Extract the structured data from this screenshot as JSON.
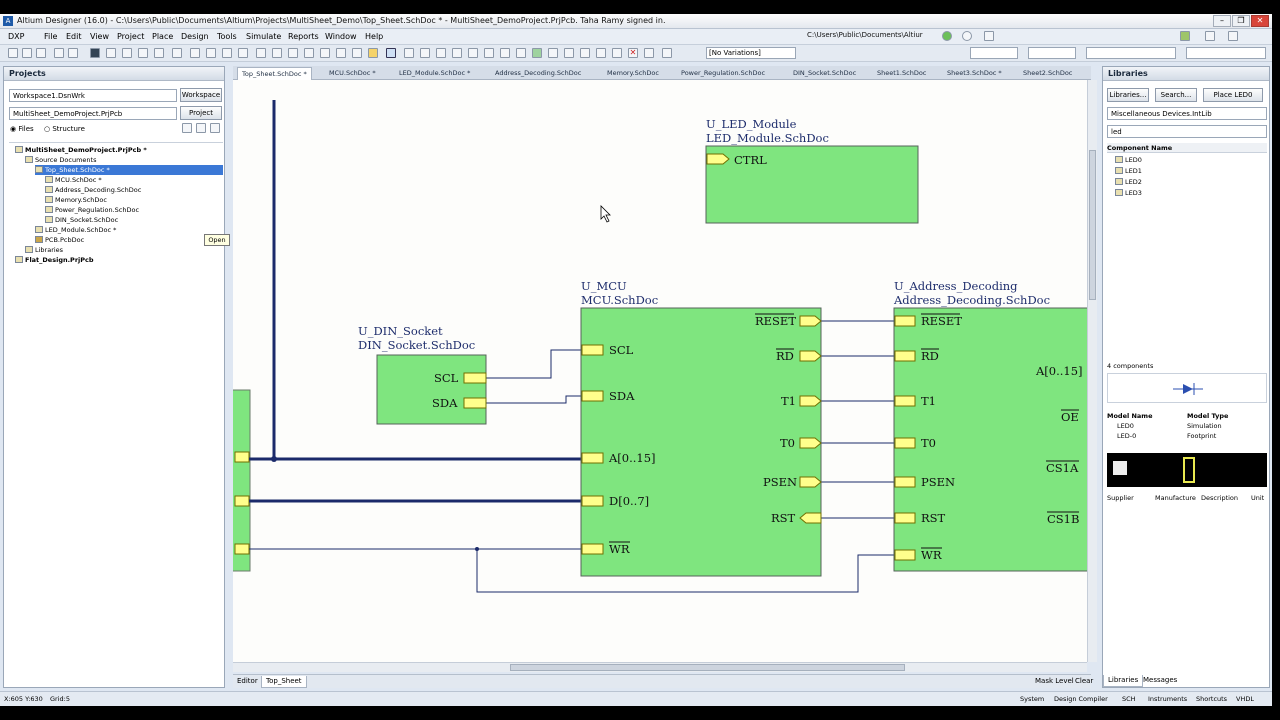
{
  "window": {
    "title": "Altium Designer (16.0) - C:\\Users\\Public\\Documents\\Altium\\Projects\\MultiSheet_Demo\\Top_Sheet.SchDoc * - MultiSheet_DemoProject.PrjPcb. Taha Ramy signed in.",
    "app_icon": "A"
  },
  "menu": {
    "items": [
      "DXP",
      "File",
      "Edit",
      "View",
      "Project",
      "Place",
      "Design",
      "Tools",
      "Simulate",
      "Reports",
      "Window",
      "Help"
    ],
    "path": "C:\\Users\\Public\\Documents\\Altiur"
  },
  "toolbar": {
    "variations": "[No Variations]"
  },
  "projects_panel": {
    "title": "Projects",
    "workspace_combo": "Workspace1.DsnWrk",
    "workspace_button": "Workspace",
    "project_combo": "MultiSheet_DemoProject.PrjPcb",
    "project_button": "Project",
    "files_label": "Files",
    "structure_label": "Structure",
    "tree": [
      {
        "label": "MultiSheet_DemoProject.PrjPcb *",
        "bold": true
      },
      {
        "label": "Source Documents"
      },
      {
        "label": "Top_Sheet.SchDoc *",
        "selected": true
      },
      {
        "label": "MCU.SchDoc *"
      },
      {
        "label": "Address_Decoding.SchDoc"
      },
      {
        "label": "Memory.SchDoc"
      },
      {
        "label": "Power_Regulation.SchDoc"
      },
      {
        "label": "DIN_Socket.SchDoc"
      },
      {
        "label": "LED_Module.SchDoc *"
      },
      {
        "label": "PCB.PcbDoc"
      },
      {
        "label": "Libraries"
      },
      {
        "label": "Flat_Design.PrjPcb",
        "bold": true
      }
    ],
    "tooltip": "Open"
  },
  "doc_tabs": [
    "Top_Sheet.SchDoc *",
    "MCU.SchDoc *",
    "LED_Module.SchDoc *",
    "Address_Decoding.SchDoc",
    "Memory.SchDoc",
    "Power_Regulation.SchDoc",
    "DIN_Socket.SchDoc",
    "Sheet1.SchDoc",
    "Sheet3.SchDoc *",
    "Sheet2.SchDoc"
  ],
  "schematic": {
    "led_module": {
      "designator": "U_LED_Module",
      "filename": "LED_Module.SchDoc",
      "ports": [
        "CTRL"
      ]
    },
    "din_socket": {
      "designator": "U_DIN_Socket",
      "filename": "DIN_Socket.SchDoc",
      "ports": [
        "SCL",
        "SDA"
      ]
    },
    "mcu": {
      "designator": "U_MCU",
      "filename": "MCU.SchDoc",
      "left_ports": [
        "SCL",
        "SDA",
        "A[0..15]",
        "D[0..7]",
        "WR"
      ],
      "right_ports": [
        "RESET",
        "RD",
        "T1",
        "T0",
        "PSEN",
        "RST"
      ]
    },
    "address_decoding": {
      "designator": "U_Address_Decoding",
      "filename": "Address_Decoding.SchDoc",
      "left_ports": [
        "RESET",
        "RD",
        "T1",
        "T0",
        "PSEN",
        "RST",
        "WR"
      ],
      "right_ports": [
        "A[0..15] [",
        "OE",
        "CS1A",
        "CS1B"
      ]
    }
  },
  "bottom_tabs": [
    "Editor",
    "Top_Sheet"
  ],
  "bottom_right": [
    "Mask Level",
    "Clear"
  ],
  "libraries_panel": {
    "title": "Libraries",
    "buttons": [
      "Libraries...",
      "Search...",
      "Place LED0"
    ],
    "library_combo": "Miscellaneous Devices.IntLib",
    "filter": "led",
    "column_header": "Component Name",
    "components": [
      "LED0",
      "LED1",
      "LED2",
      "LED3"
    ],
    "count": "4 components",
    "model_headers": [
      "Model Name",
      "Model Type"
    ],
    "models": [
      [
        "LED0",
        "Simulation"
      ],
      [
        "LED-0",
        "Footprint"
      ]
    ],
    "supplier_headers": [
      "Supplier",
      "Manufacture",
      "Description",
      "Unit"
    ],
    "tabs": [
      "Libraries",
      "Messages"
    ]
  },
  "status": {
    "coords": "X:605 Y:630",
    "grid": "Grid:5",
    "right_items": [
      "System",
      "Design Compiler",
      "SCH",
      "Instruments",
      "Shortcuts",
      "VHDL"
    ]
  },
  "colors": {
    "sheet_fill": "#7fe57f",
    "port_fill": "#ffff8c",
    "bus": "#1b2a6a",
    "wire": "#1b2a6a"
  }
}
